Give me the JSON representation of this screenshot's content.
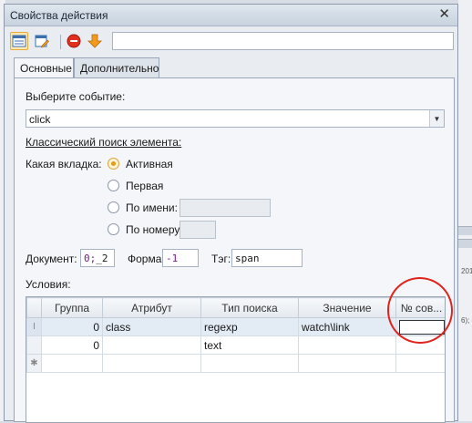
{
  "window": {
    "title": "Свойства действия",
    "close_glyph": "✕",
    "command_value": ""
  },
  "tabs": [
    {
      "label": "Основные",
      "active": true
    },
    {
      "label": "Дополнительно",
      "active": false
    }
  ],
  "event": {
    "label": "Выберите событие:",
    "value": "click"
  },
  "classic": {
    "heading": "Классический поиск элемента:",
    "tab_label": "Какая вкладка:",
    "options": [
      {
        "label": "Активная",
        "checked": true
      },
      {
        "label": "Первая",
        "checked": false
      },
      {
        "label": "По имени:",
        "checked": false
      },
      {
        "label": "По номеру:",
        "checked": false
      }
    ]
  },
  "fields": {
    "document_label": "Документ:",
    "document_value_a": "0;",
    "document_value_b": "_2",
    "form_label": "Форма:",
    "form_value": "-1",
    "tag_label": "Тэг:",
    "tag_value": "span"
  },
  "conditions": {
    "label": "Условия:",
    "columns": [
      "Группа",
      "Атрибут",
      "Тип поиска",
      "Значение",
      "№ сов..."
    ],
    "rows": [
      {
        "indicator": "I",
        "group": "0",
        "attribute": "class",
        "search_type": "regexp",
        "value": "watch\\link",
        "match_no": ""
      },
      {
        "indicator": "",
        "group": "0",
        "attribute": "",
        "search_type": "text",
        "value": "",
        "match_no": ""
      },
      {
        "indicator": "✱",
        "group": "",
        "attribute": "",
        "search_type": "",
        "value": "",
        "match_no": ""
      }
    ]
  },
  "background": {
    "snippets": [
      "201",
      "6);"
    ]
  },
  "colors": {
    "accent_orange": "#e39b1a",
    "annotation_red": "#e0241c",
    "stop_red": "#e0301e"
  },
  "icons": {
    "toolbar": [
      "table-view-icon",
      "edit-table-icon",
      "stop-icon",
      "down-arrow-icon"
    ]
  }
}
